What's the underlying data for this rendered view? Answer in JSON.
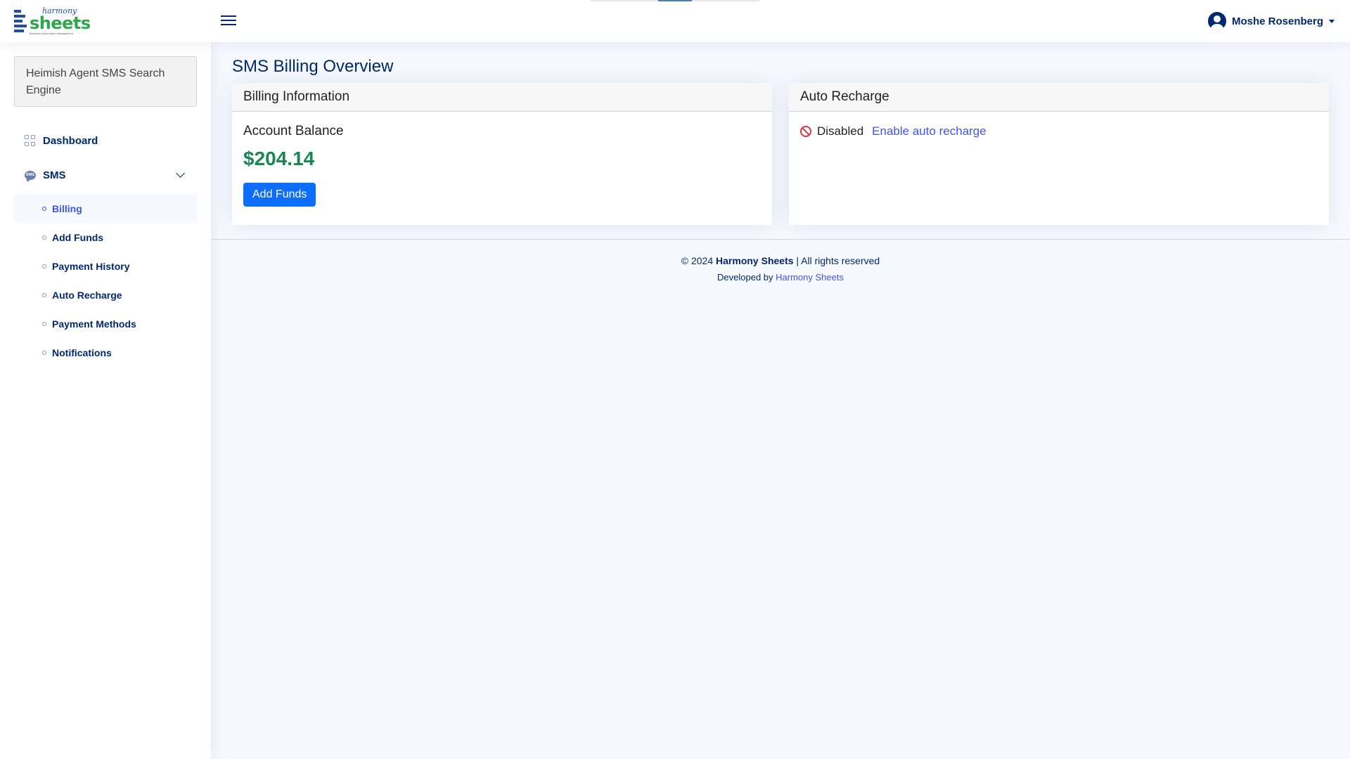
{
  "header": {
    "logo": {
      "top_text": "harmony",
      "main_text": "sheets",
      "tagline": "Business Automation Management"
    },
    "user": {
      "name": "Moshe Rosenberg"
    }
  },
  "sidebar": {
    "org": "Heimish Agent SMS Search Engine",
    "items": [
      {
        "label": "Dashboard",
        "icon": "grid-icon"
      },
      {
        "label": "SMS",
        "icon": "chat-icon",
        "icon_text": "SMS",
        "expanded": true
      }
    ],
    "sms_items": [
      {
        "label": "Billing",
        "active": true
      },
      {
        "label": "Add Funds"
      },
      {
        "label": "Payment History"
      },
      {
        "label": "Auto Recharge"
      },
      {
        "label": "Payment Methods"
      },
      {
        "label": "Notifications"
      }
    ]
  },
  "main": {
    "title": "SMS Billing Overview",
    "billing": {
      "header": "Billing Information",
      "label": "Account Balance",
      "balance": "$204.14",
      "button": "Add Funds"
    },
    "auto_recharge": {
      "header": "Auto Recharge",
      "status": "Disabled",
      "link": "Enable auto recharge"
    }
  },
  "footer": {
    "copy_prefix": "© 2024",
    "brand": "Harmony Sheets",
    "copy_suffix": "| All rights reserved",
    "developed_prefix": "Developed by",
    "developer": "Harmony Sheets"
  },
  "colors": {
    "primary": "#012970",
    "accent": "#4154f1",
    "button": "#0d6efd",
    "balance": "#198754",
    "danger": "#dc3545",
    "background": "#f6f9ff"
  }
}
